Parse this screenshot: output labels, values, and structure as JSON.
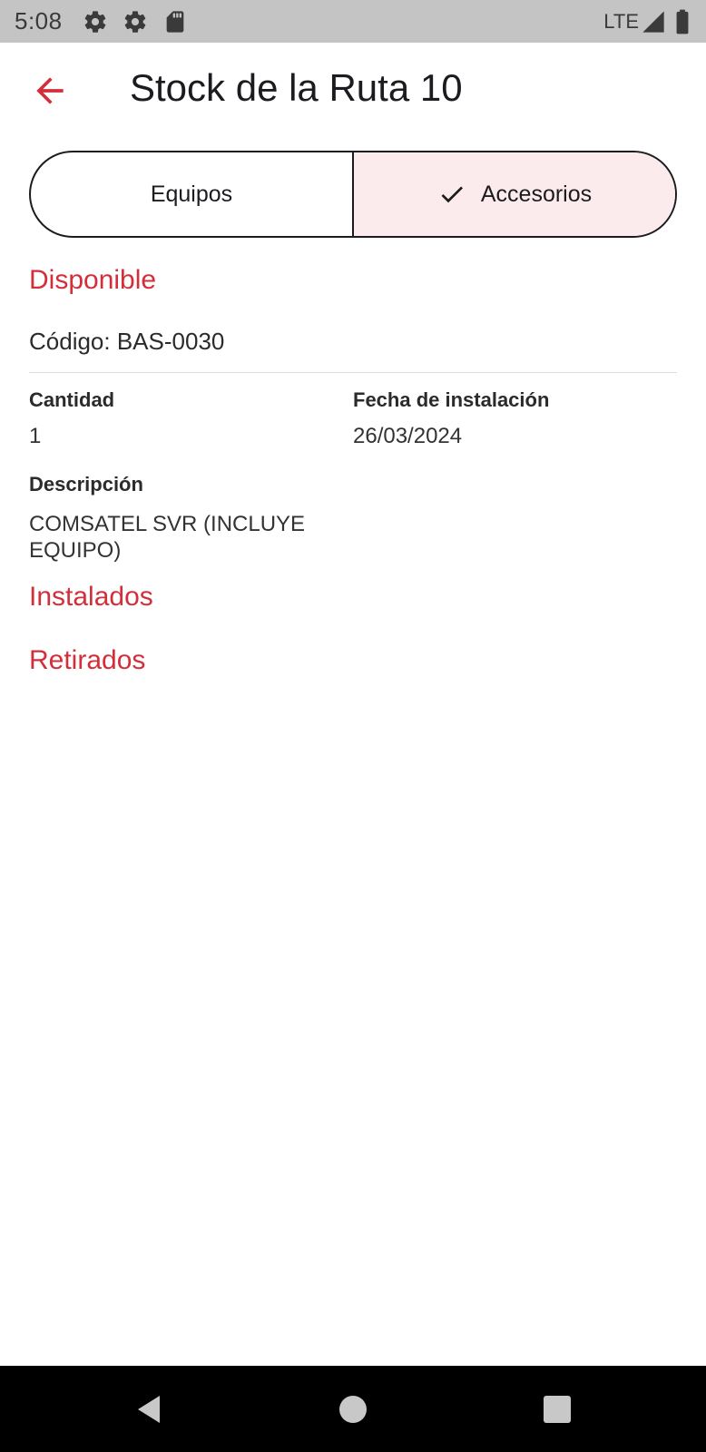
{
  "status_bar": {
    "time": "5:08",
    "network": "LTE",
    "icons": [
      "settings-icon",
      "settings-icon",
      "sd-card-icon",
      "signal-icon",
      "battery-icon"
    ]
  },
  "app_bar": {
    "title": "Stock de la Ruta 10",
    "back_icon": "arrow-back-icon"
  },
  "tabs": [
    {
      "label": "Equipos",
      "selected": false
    },
    {
      "label": "Accesorios",
      "selected": true,
      "icon": "check-icon"
    }
  ],
  "sections": {
    "available": "Disponible",
    "installed": "Instalados",
    "removed": "Retirados"
  },
  "item": {
    "code_line": "Código: BAS-0030",
    "quantity_label": "Cantidad",
    "quantity_value": "1",
    "date_label": "Fecha de instalación",
    "date_value": "26/03/2024",
    "description_label": "Descripción",
    "description_value": "COMSATEL SVR (INCLUYE EQUIPO)"
  },
  "nav_bar": {
    "icons": [
      "nav-back-icon",
      "nav-home-icon",
      "nav-recents-icon"
    ]
  },
  "colors": {
    "accent": "#d32f3a",
    "selected_tab_bg": "#fcebec",
    "status_bar_bg": "#c4c4c4",
    "nav_bar_bg": "#000000"
  }
}
